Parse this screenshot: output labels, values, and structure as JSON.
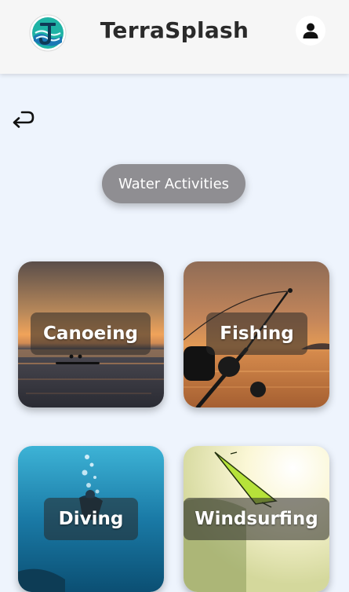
{
  "header": {
    "title": "TerraSplash",
    "logo_icon": "terrasplash-logo-icon",
    "account_icon": "user-icon"
  },
  "back": {
    "icon": "return-arrow-icon"
  },
  "category": {
    "label": "Water Activities"
  },
  "activities": [
    {
      "label": "Canoeing",
      "image": "sunset canoe on water"
    },
    {
      "label": "Fishing",
      "image": "fishing rod at sunset"
    },
    {
      "label": "Diving",
      "image": "underwater diver"
    },
    {
      "label": "Windsurfing",
      "image": "windsurf sail in sunlight"
    }
  ],
  "colors": {
    "background": "#eef4fd",
    "header": "#f6f6f6",
    "chip": "#8f8e92",
    "label_overlay": "rgba(40,40,40,0.55)",
    "title_text": "#2a2a2a"
  }
}
